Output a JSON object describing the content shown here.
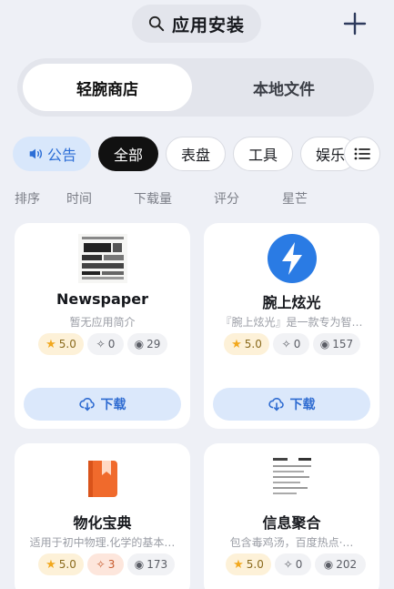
{
  "header": {
    "title": "应用安装"
  },
  "tabs": {
    "store": "轻腕商店",
    "local": "本地文件"
  },
  "filters": {
    "notice": "公告",
    "all": "全部",
    "dial": "表盘",
    "tool": "工具",
    "entertainment": "娱乐"
  },
  "sort": {
    "label": "排序",
    "time": "时间",
    "downloads": "下载量",
    "rating": "评分",
    "stars": "星芒"
  },
  "apps": [
    {
      "name": "Newspaper",
      "desc": "暂无应用简介",
      "rating": "5.0",
      "likes": "0",
      "downloads": "29",
      "button": "下载"
    },
    {
      "name": "腕上炫光",
      "desc": "『腕上炫光』是一款专为智…",
      "rating": "5.0",
      "likes": "0",
      "downloads": "157",
      "button": "下载"
    },
    {
      "name": "物化宝典",
      "desc": "适用于初中物理.化学的基本…",
      "rating": "5.0",
      "likes": "3",
      "downloads": "173"
    },
    {
      "name": "信息聚合",
      "desc": "包含毒鸡汤，百度热点·…",
      "rating": "5.0",
      "likes": "0",
      "downloads": "202"
    }
  ],
  "colors": {
    "accent": "#2e6bd1",
    "background": "#eef0f6",
    "rating_bg": "#fdf1d8",
    "active_chip": "#111111"
  },
  "icons": {
    "search": "search-icon",
    "add": "plus-icon",
    "notice": "speaker-icon",
    "list": "list-icon",
    "download": "cloud-download-icon",
    "like": "sparkle-icon",
    "views": "eye-icon",
    "star": "star-icon"
  }
}
